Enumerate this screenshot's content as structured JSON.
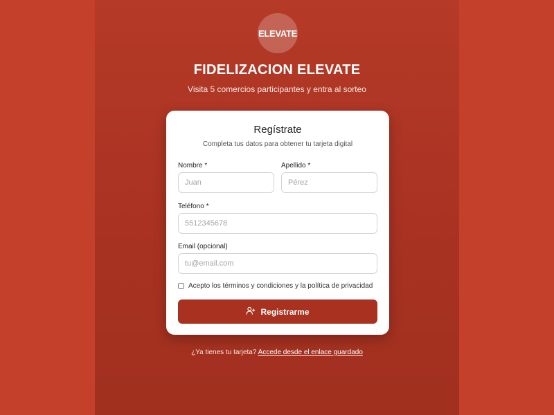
{
  "brand": {
    "logo_text": "ELEVATE",
    "title": "FIDELIZACION ELEVATE",
    "subtitle": "Visita 5 comercios participantes y entra al sorteo"
  },
  "card": {
    "title": "Regístrate",
    "subtitle": "Completa tus datos para obtener tu tarjeta digital"
  },
  "form": {
    "nombre": {
      "label": "Nombre *",
      "placeholder": "Juan",
      "value": ""
    },
    "apellido": {
      "label": "Apellido *",
      "placeholder": "Pérez",
      "value": ""
    },
    "telefono": {
      "label": "Teléfono *",
      "placeholder": "5512345678",
      "value": ""
    },
    "email": {
      "label": "Email (opcional)",
      "placeholder": "tu@email.com",
      "value": ""
    },
    "terms_label": "Acepto los términos y condiciones y la política de privacidad",
    "terms_checked": false,
    "submit_label": "Registrarme",
    "submit_icon": "user-plus-icon"
  },
  "footer": {
    "prompt": "¿Ya tienes tu tarjeta?",
    "link_text": "Accede desde el enlace guardado"
  },
  "colors": {
    "background": "#c13d28",
    "primary": "#a8321f",
    "card": "#ffffff"
  }
}
